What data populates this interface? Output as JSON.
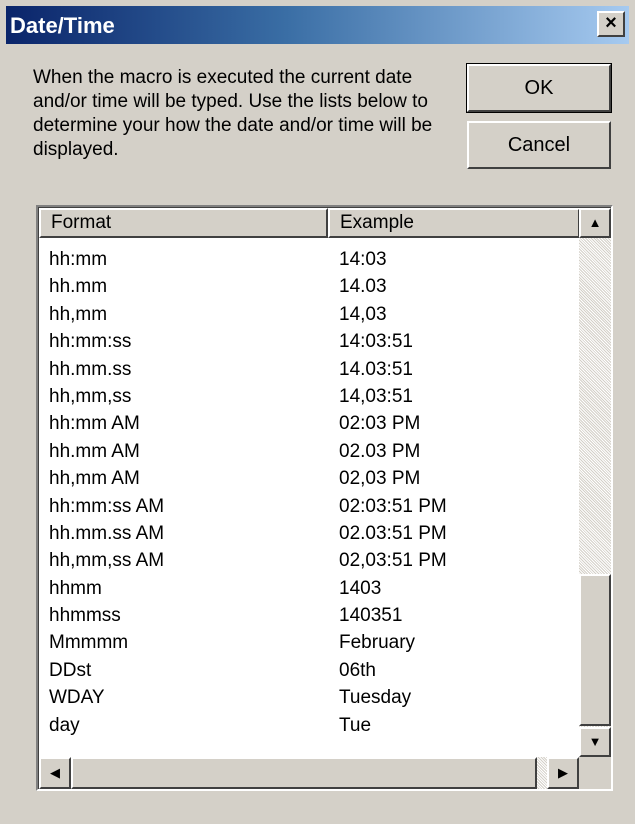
{
  "window": {
    "title": "Date/Time",
    "close_glyph": "×"
  },
  "description": "When the macro is executed the current date and/or time will be typed.  Use the lists below to determine your how the date and/or time will be displayed.",
  "buttons": {
    "ok": "OK",
    "cancel": "Cancel"
  },
  "list": {
    "columns": [
      "Format",
      "Example"
    ],
    "rows": [
      {
        "format": "hh:mm",
        "example": "14:03"
      },
      {
        "format": "hh.mm",
        "example": "14.03"
      },
      {
        "format": "hh,mm",
        "example": "14,03"
      },
      {
        "format": "hh:mm:ss",
        "example": "14:03:51"
      },
      {
        "format": "hh.mm.ss",
        "example": "14.03:51"
      },
      {
        "format": "hh,mm,ss",
        "example": "14,03:51"
      },
      {
        "format": "hh:mm AM",
        "example": "02:03 PM"
      },
      {
        "format": "hh.mm AM",
        "example": "02.03 PM"
      },
      {
        "format": "hh,mm AM",
        "example": "02,03 PM"
      },
      {
        "format": "hh:mm:ss AM",
        "example": "02:03:51 PM"
      },
      {
        "format": "hh.mm.ss AM",
        "example": "02.03:51 PM"
      },
      {
        "format": "hh,mm,ss AM",
        "example": "02,03:51 PM"
      },
      {
        "format": "hhmm",
        "example": "1403"
      },
      {
        "format": "hhmmss",
        "example": "140351"
      },
      {
        "format": "Mmmmm",
        "example": "February"
      },
      {
        "format": "DDst",
        "example": "06th"
      },
      {
        "format": "WDAY",
        "example": "Tuesday"
      },
      {
        "format": "day",
        "example": "Tue"
      }
    ]
  },
  "scrollbar_glyphs": {
    "up": "▲",
    "down": "▼",
    "left": "◀",
    "right": "▶"
  }
}
